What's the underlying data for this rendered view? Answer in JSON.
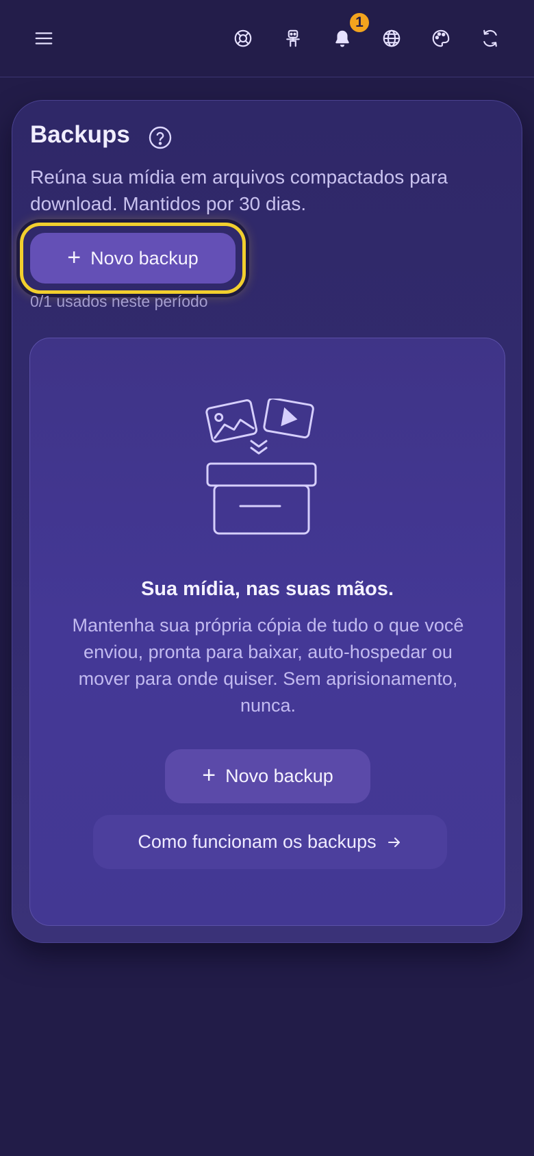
{
  "header": {
    "menu_icon": "hamburger-icon",
    "icons": [
      "lifebuoy-icon",
      "robot-icon",
      "bell-icon",
      "globe-icon",
      "palette-icon",
      "refresh-icon"
    ],
    "notification_count": "1"
  },
  "backups": {
    "title": "Backups",
    "description": "Reúna sua mídia em arquivos compactados para download. Mantidos por 30 dias.",
    "new_backup_label": "Novo backup",
    "usage_text": "0/1 usados neste período"
  },
  "empty_state": {
    "title": "Sua mídia, nas suas mãos.",
    "description": "Mantenha sua própria cópia de tudo o que você enviou, pronta para baixar, auto-hospedar ou mover para onde quiser. Sem aprisionamento, nunca.",
    "new_backup_label": "Novo backup",
    "how_it_works_label": "Como funcionam os backups"
  },
  "colors": {
    "background": "#221c48",
    "card": "#2f2868",
    "accent": "#6450b6",
    "focus_ring": "#f2cf2e",
    "badge": "#f3a41e"
  }
}
